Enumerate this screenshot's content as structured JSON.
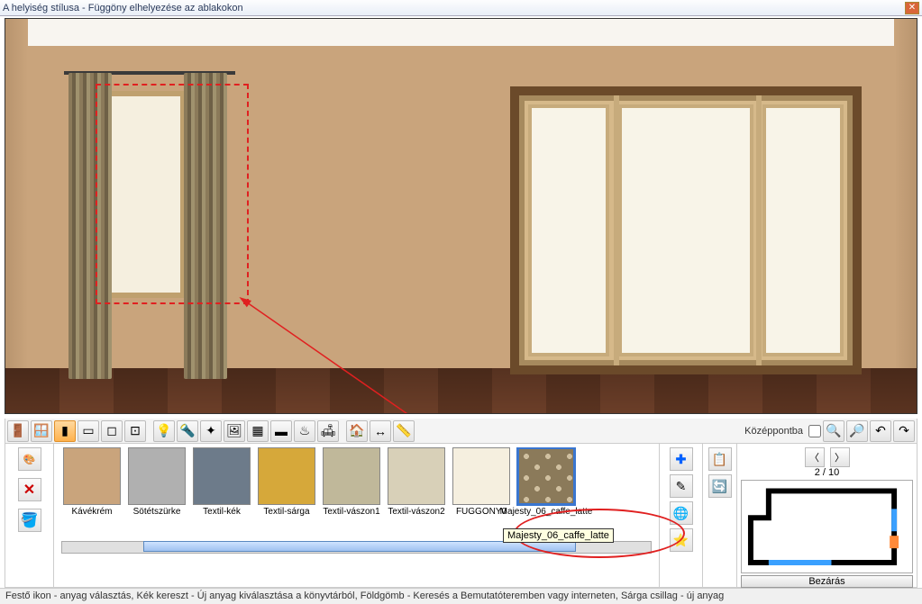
{
  "window": {
    "title": "A helyiség stílusa - Függöny elhelyezése az ablakokon"
  },
  "toolbar": {
    "center_label": "Középpontba"
  },
  "swatches": [
    {
      "name": "Kávékrém",
      "color": "#c9a47c"
    },
    {
      "name": "Sötétszürke",
      "color": "#b0b0b0"
    },
    {
      "name": "Textil-kék",
      "color": "#6d7b8a"
    },
    {
      "name": "Textil-sárga",
      "color": "#d6a83a"
    },
    {
      "name": "Textil-vászon1",
      "color": "#c0b89a"
    },
    {
      "name": "Textil-vászon2",
      "color": "#d8d0b8"
    },
    {
      "name": "FUGGONY0",
      "color": "#f5efdf"
    },
    {
      "name": "Majesty_06_caffe_latte",
      "pattern": true
    }
  ],
  "selected_swatch": 7,
  "tooltip": "Majesty_06_caffe_latte",
  "plan": {
    "page": "2 / 10",
    "close": "Bezárás"
  },
  "status": "Festő ikon - anyag választás, Kék kereszt - Új anyag kiválasztása a könyvtárból, Földgömb - Keresés a Bemutatóteremben vagy interneten, Sárga csillag - új anyag"
}
